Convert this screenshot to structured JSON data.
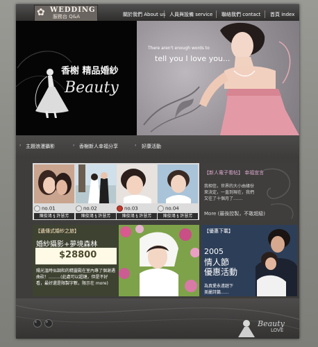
{
  "logo": {
    "title": "WEDDING",
    "subtitle": "服務台 Q&A"
  },
  "nav": [
    {
      "label": "關於我們 About us"
    },
    {
      "label": "人員與設備 service"
    },
    {
      "label": "聯絡我們 contact"
    },
    {
      "label": "首頁 index"
    }
  ],
  "hero": {
    "title": "香榭 精品婚紗",
    "script_word": "Beauty",
    "tagline_small": "There aren't enough words to",
    "tagline_large": "tell you I  love you..."
  },
  "subnav": [
    {
      "label": "主題浪漫攝影"
    },
    {
      "label": "香榭新人幸福分享"
    },
    {
      "label": "好康活動"
    }
  ],
  "gallery": [
    {
      "number": "no.01",
      "caption": "陳俊鴻 § 許慧芳"
    },
    {
      "number": "no.02",
      "caption": "陳俊鴻 § 許慧芳"
    },
    {
      "number": "no.03",
      "caption": "陳俊鴻 § 許慧芳"
    },
    {
      "number": "no.04",
      "caption": "陳俊鴻 § 許慧芳"
    }
  ],
  "news": {
    "title": "【新人電子看帖】 幸福宣言",
    "body": "我相信，世界的大小由緣份來決定，一直到現在，我們又往了十個月了.......",
    "more": "More (最後控製，不敢超級)"
  },
  "promo": {
    "heading": "【遺傳式婚紗之旅】",
    "title": "婚紗攝影+夢境森林",
    "price": "$28800",
    "description": "陽光溫時似調和的精靈殿在室內專了個谢遇曲砍！.........(此處可以超鏈，但是不好看，最好還是限製字數，限示在 more)"
  },
  "event": {
    "heading": "【優惠下載】",
    "year": "2005",
    "line1": "情人節",
    "line2": "優惠活動",
    "note1": "為真愛永遠趟下",
    "note2": "美麗詩篇......"
  },
  "footer": {
    "script_word": "Beauty",
    "love": "LOVE"
  },
  "colors": {
    "frame": "#3e3d3b",
    "promo_green": "#3e4231",
    "news_accent": "#d8a7c9",
    "event_blue": "#2b3a52"
  }
}
